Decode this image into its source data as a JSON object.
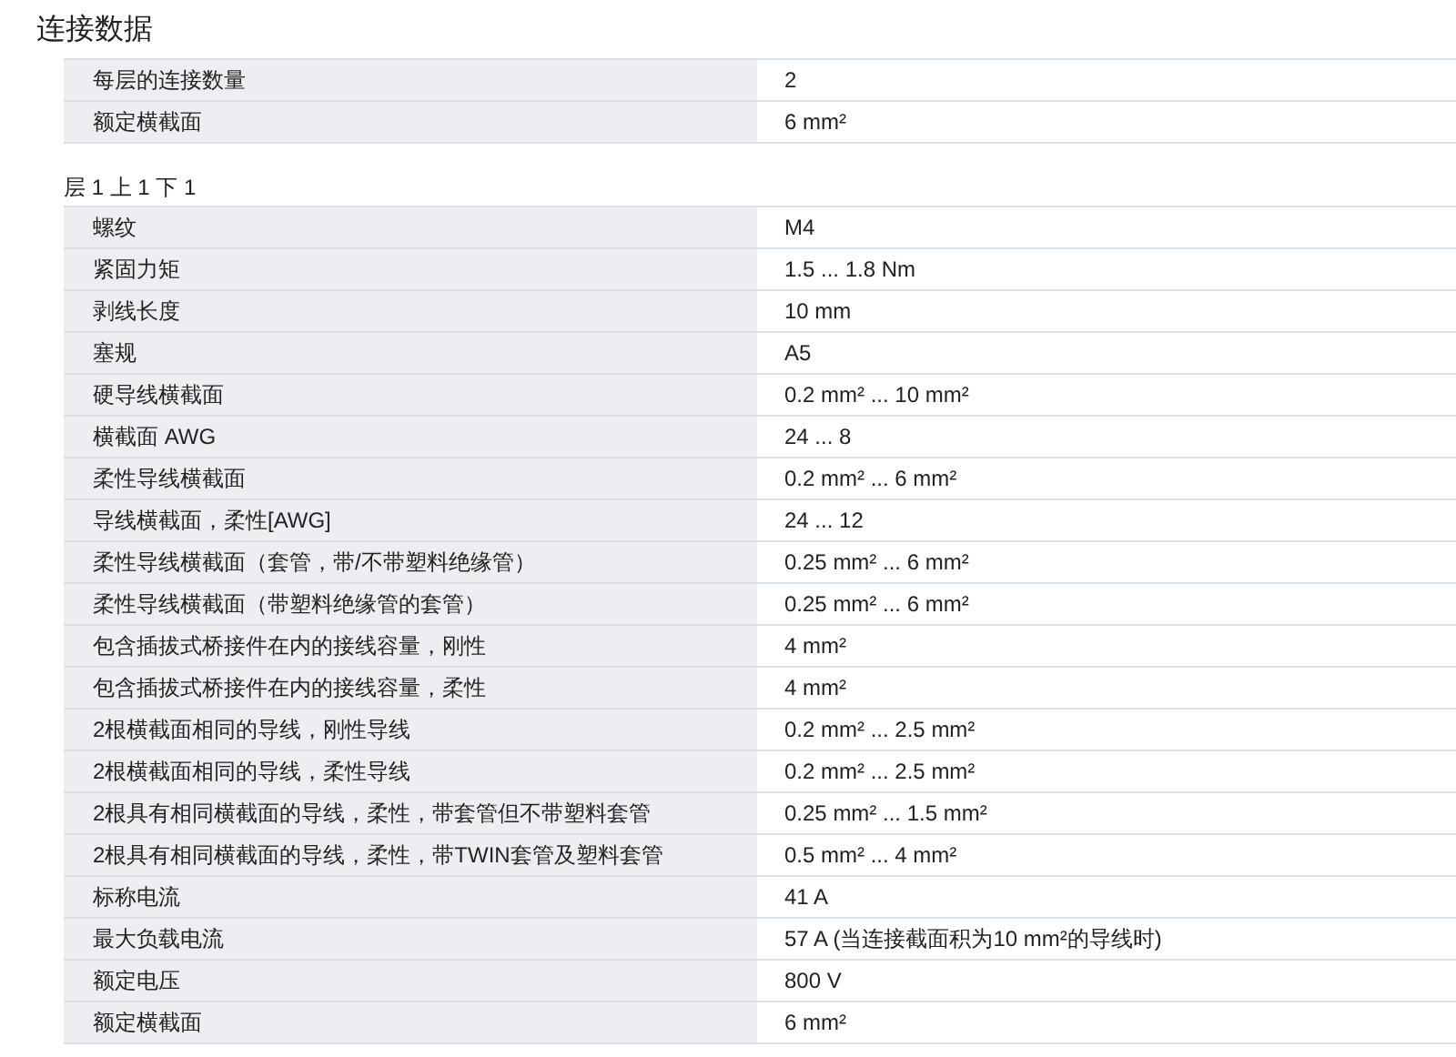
{
  "title": "连接数据",
  "sections": [
    {
      "rows": [
        {
          "label": "每层的连接数量",
          "value": "2"
        },
        {
          "label": "额定横截面",
          "value": "6 mm²"
        }
      ]
    },
    {
      "heading": "层 1 上 1 下 1",
      "rows": [
        {
          "label": "螺纹",
          "value": "M4"
        },
        {
          "label": "紧固力矩",
          "value": "1.5 ... 1.8 Nm"
        },
        {
          "label": "剥线长度",
          "value": "10 mm"
        },
        {
          "label": "塞规",
          "value": "A5"
        },
        {
          "label": "硬导线横截面",
          "value": "0.2 mm² ... 10 mm²"
        },
        {
          "label": "横截面 AWG",
          "value": "24 ... 8"
        },
        {
          "label": "柔性导线横截面",
          "value": "0.2 mm² ... 6 mm²"
        },
        {
          "label": "导线横截面，柔性[AWG]",
          "value": "24 ... 12"
        },
        {
          "label": "柔性导线横截面（套管，带/不带塑料绝缘管）",
          "value": "0.25 mm² ... 6 mm²"
        },
        {
          "label": "柔性导线横截面（带塑料绝缘管的套管）",
          "value": "0.25 mm² ... 6 mm²"
        },
        {
          "label": "包含插拔式桥接件在内的接线容量，刚性",
          "value": "4 mm²"
        },
        {
          "label": "包含插拔式桥接件在内的接线容量，柔性",
          "value": "4 mm²"
        },
        {
          "label": "2根横截面相同的导线，刚性导线",
          "value": "0.2 mm² ... 2.5 mm²"
        },
        {
          "label": "2根横截面相同的导线，柔性导线",
          "value": "0.2 mm² ... 2.5 mm²"
        },
        {
          "label": "2根具有相同横截面的导线，柔性，带套管但不带塑料套管",
          "value": "0.25 mm² ... 1.5 mm²"
        },
        {
          "label": "2根具有相同横截面的导线，柔性，带TWIN套管及塑料套管",
          "value": "0.5 mm² ... 4 mm²"
        },
        {
          "label": "标称电流",
          "value": "41 A"
        },
        {
          "label": "最大负载电流",
          "value": "57 A (当连接截面积为10 mm²的导线时)"
        },
        {
          "label": "额定电压",
          "value": "800 V"
        },
        {
          "label": "额定横截面",
          "value": "6 mm²"
        }
      ]
    }
  ]
}
